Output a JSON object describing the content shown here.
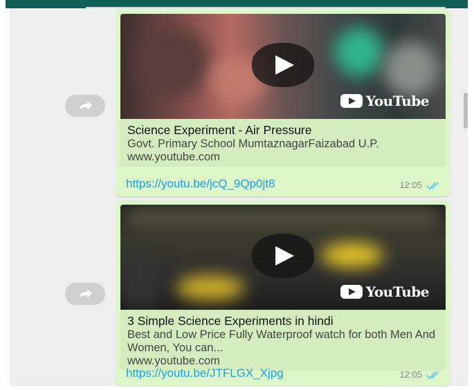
{
  "messages": [
    {
      "title": "Science Experiment - Air Pressure",
      "description": "Govt. Primary School MumtaznagarFaizabad U.P.",
      "site": "www.youtube.com",
      "link": "https://youtu.be/jcQ_9Qp0jt8",
      "time": "12:05",
      "brand": "YouTube",
      "status": "read"
    },
    {
      "title": "3 Simple Science Experiments in hindi",
      "description": "Best and Low Price Fully Waterproof watch for both Men And Women, You can...",
      "site": "www.youtube.com",
      "link": "https://youtu.be/JTFLGX_Xjpg",
      "time": "12:05",
      "brand": "YouTube",
      "status": "read"
    }
  ],
  "icons": {
    "forward": "forward-arrow-icon",
    "play": "play-icon",
    "read_receipt": "double-check-icon"
  },
  "colors": {
    "header": "#0f5f55",
    "bubble": "#dcf6c8",
    "link": "#1ba1e2",
    "tick": "#4fc3f7"
  }
}
